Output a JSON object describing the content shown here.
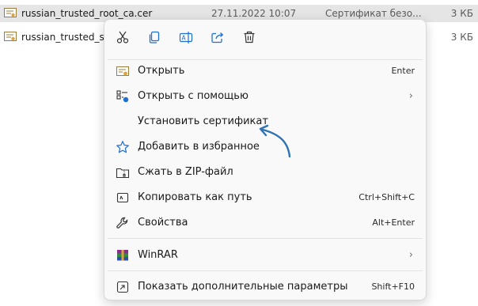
{
  "files": [
    {
      "name": "russian_trusted_root_ca.cer",
      "date": "27.11.2022 10:07",
      "type": "Сертификат безо...",
      "size": "3 КБ",
      "selected": true
    },
    {
      "name": "russian_trusted_sub",
      "date": "",
      "type": "",
      "size": "3 КБ",
      "selected": false
    }
  ],
  "toolbar": {
    "icons": [
      "cut-icon",
      "copy-icon",
      "rename-icon",
      "share-icon",
      "delete-icon"
    ]
  },
  "menu": {
    "open": {
      "label": "Открыть",
      "shortcut": "Enter"
    },
    "open_with": {
      "label": "Открыть с помощью"
    },
    "install_cert": {
      "label": "Установить сертификат"
    },
    "favorites": {
      "label": "Добавить в избранное"
    },
    "zip": {
      "label": "Сжать в ZIP-файл"
    },
    "copy_path": {
      "label": "Копировать как путь",
      "shortcut": "Ctrl+Shift+C"
    },
    "properties": {
      "label": "Свойства",
      "shortcut": "Alt+Enter"
    },
    "winrar": {
      "label": "WinRAR"
    },
    "more_options": {
      "label": "Показать дополнительные параметры",
      "shortcut": "Shift+F10"
    }
  },
  "colors": {
    "accent": "#1f6fd1",
    "arrow": "#2f73b5"
  }
}
